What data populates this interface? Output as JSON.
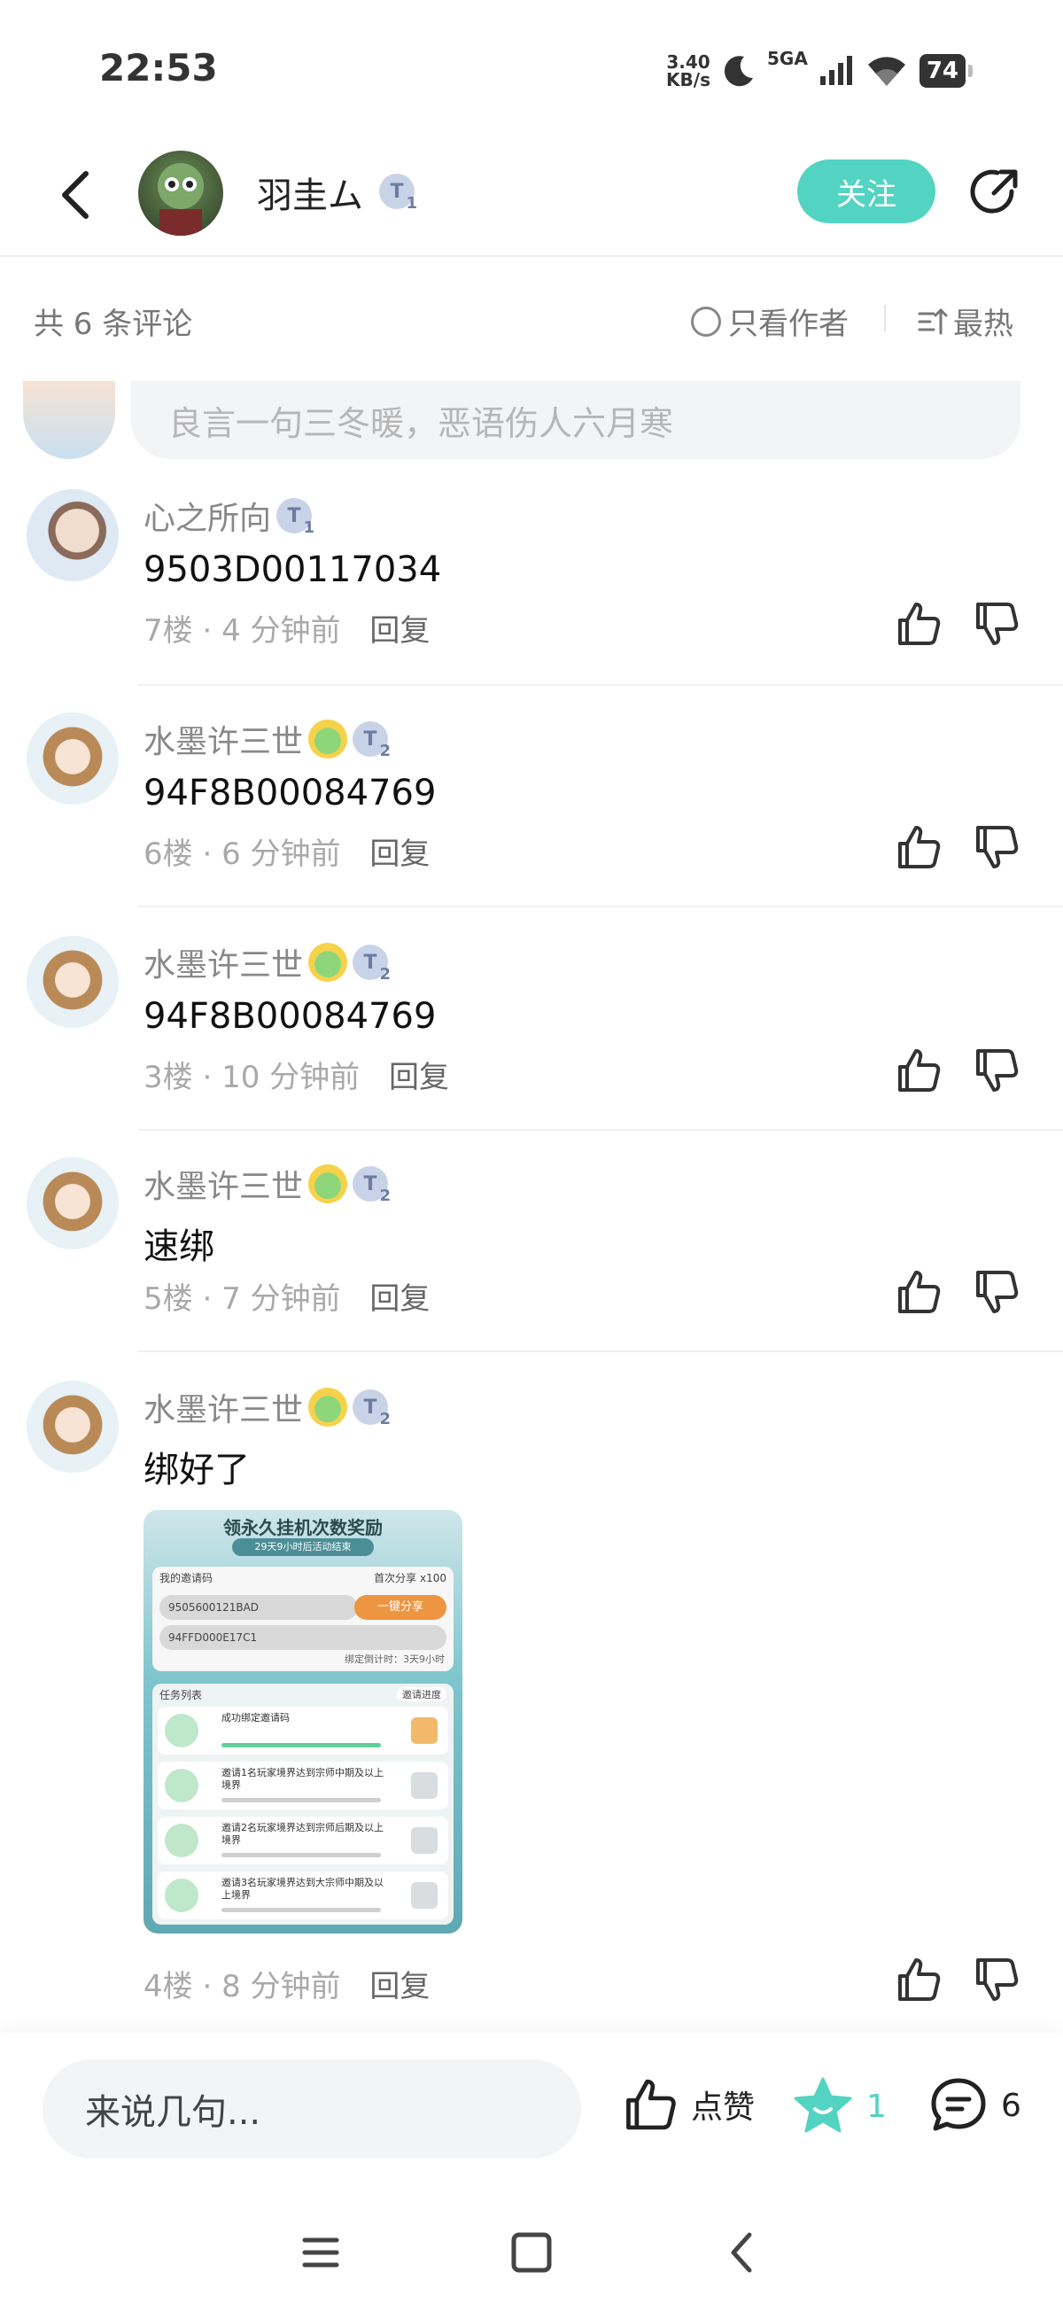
{
  "status_bar": {
    "time": "22:53",
    "net_speed_value": "3.40",
    "net_speed_unit": "KB/s",
    "network": "5GA",
    "battery": "74"
  },
  "header": {
    "author_name": "羽圭ム",
    "author_level": "1",
    "follow_label": "关注"
  },
  "comments_header": {
    "count_text": "共 6 条评论",
    "author_only_label": "只看作者",
    "sort_label": "最热"
  },
  "quick_input": {
    "placeholder": "良言一句三冬暖，恶语伤人六月寒"
  },
  "comments": [
    {
      "user": "心之所向",
      "level": "1",
      "text": "9503D00117034",
      "floor": "7楼",
      "time": "4 分钟前",
      "reply_label": "回复"
    },
    {
      "user": "水墨许三世",
      "level": "2",
      "text": "94F8B00084769",
      "floor": "6楼",
      "time": "6 分钟前",
      "reply_label": "回复"
    },
    {
      "user": "水墨许三世",
      "level": "2",
      "text": "94F8B00084769",
      "floor": "3楼",
      "time": "10 分钟前",
      "reply_label": "回复"
    },
    {
      "user": "水墨许三世",
      "level": "2",
      "text": "速绑",
      "floor": "5楼",
      "time": "7 分钟前",
      "reply_label": "回复"
    },
    {
      "user": "水墨许三世",
      "level": "2",
      "text": "绑好了",
      "floor": "4楼",
      "time": "8 分钟前",
      "reply_label": "回复"
    }
  ],
  "attachment": {
    "title": "领永久挂机次数奖励",
    "countdown": "29天9小时后活动结束",
    "invite_code_label": "我的邀请码",
    "first_share_label": "首次分享 x100",
    "my_code": "9505600121BAD",
    "share_button": "一键分享",
    "bound_code": "94FFD000E17C1",
    "bind_deadline": "绑定倒计时：3天9小时",
    "task_list_label": "任务列表",
    "invite_progress_label": "邀请进度",
    "tasks": [
      "成功绑定邀请码",
      "邀请1名玩家境界达到宗师中期及以上境界",
      "邀请2名玩家境界达到宗师后期及以上境界",
      "邀请3名玩家境界达到大宗师中期及以上境界"
    ]
  },
  "bottom_bar": {
    "input_placeholder": "来说几句...",
    "like_label": "点赞",
    "fav_count": "1",
    "comment_count": "6"
  },
  "colors": {
    "accent": "#53d3c2",
    "text_primary": "#111111",
    "text_secondary": "#888888",
    "divider": "#f0f0f0"
  }
}
